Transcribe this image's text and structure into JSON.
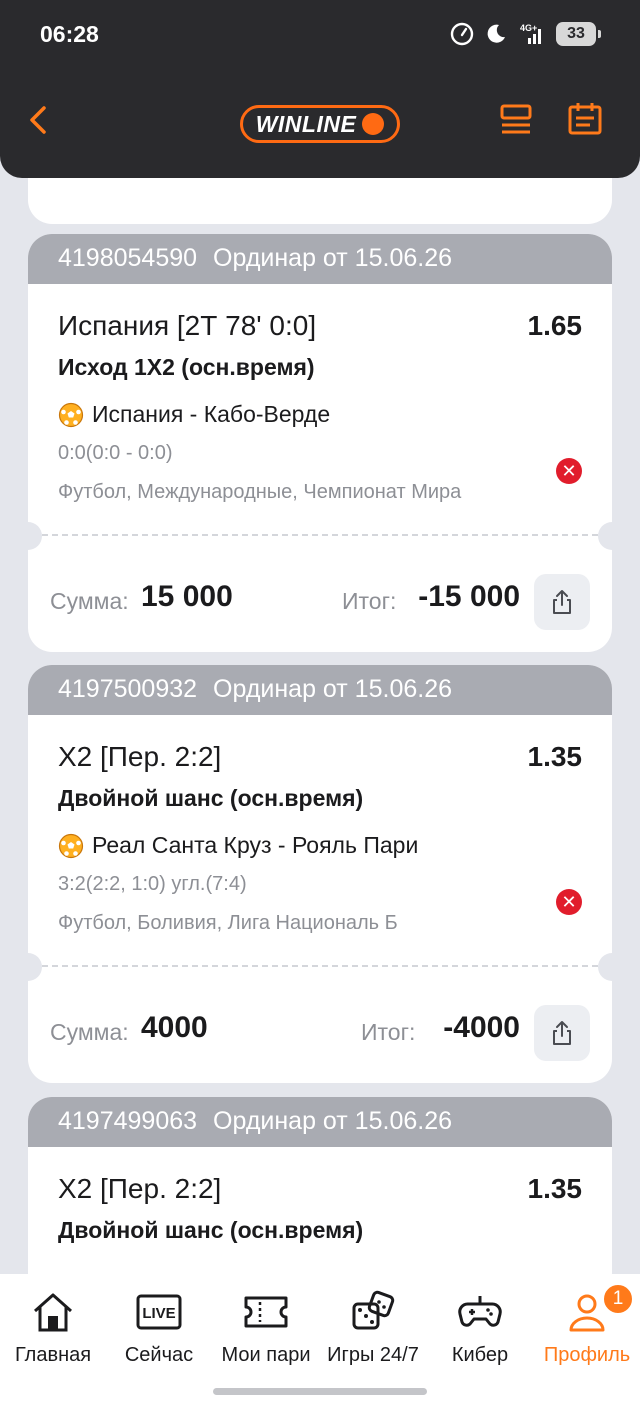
{
  "status_bar": {
    "time": "06:28",
    "battery": "33",
    "network": "4G+"
  },
  "header": {
    "logo_text": "WINLINE",
    "accent": "#ff6a13"
  },
  "bets": [
    {
      "id": "4198054590",
      "title": "Ординар от 15.06.26",
      "selection": "Испания [2Т 78' 0:0]",
      "odds": "1.65",
      "market": "Исход 1Х2 (осн.время)",
      "event": "Испания - Кабо-Верде",
      "score": "0:0(0:0 - 0:0)",
      "league": "Футбол, Международные, Чемпионат Мира",
      "sum_label": "Сумма:",
      "sum": "15 000",
      "total_label": "Итог:",
      "total": "-15 000"
    },
    {
      "id": "4197500932",
      "title": "Ординар от 15.06.26",
      "selection": "Х2 [Пер. 2:2]",
      "odds": "1.35",
      "market": "Двойной шанс (осн.время)",
      "event": "Реал Санта Круз - Рояль Пари",
      "score": "3:2(2:2, 1:0) угл.(7:4)",
      "league": "Футбол, Боливия, Лига Националь Б",
      "sum_label": "Сумма:",
      "sum": "4000",
      "total_label": "Итог:",
      "total": "-4000"
    },
    {
      "id": "4197499063",
      "title": "Ординар от 15.06.26",
      "selection": "Х2 [Пер. 2:2]",
      "odds": "1.35",
      "market": "Двойной шанс (осн.время)"
    }
  ],
  "bottom_nav": [
    {
      "label": "Главная",
      "icon": "home-icon"
    },
    {
      "label": "Сейчас",
      "icon": "live-icon",
      "icon_text": "LIVE"
    },
    {
      "label": "Мои пари",
      "icon": "ticket-icon"
    },
    {
      "label": "Игры 24/7",
      "icon": "dice-icon"
    },
    {
      "label": "Кибер",
      "icon": "gamepad-icon"
    },
    {
      "label": "Профиль",
      "icon": "profile-icon",
      "active": true,
      "badge": "1"
    }
  ]
}
